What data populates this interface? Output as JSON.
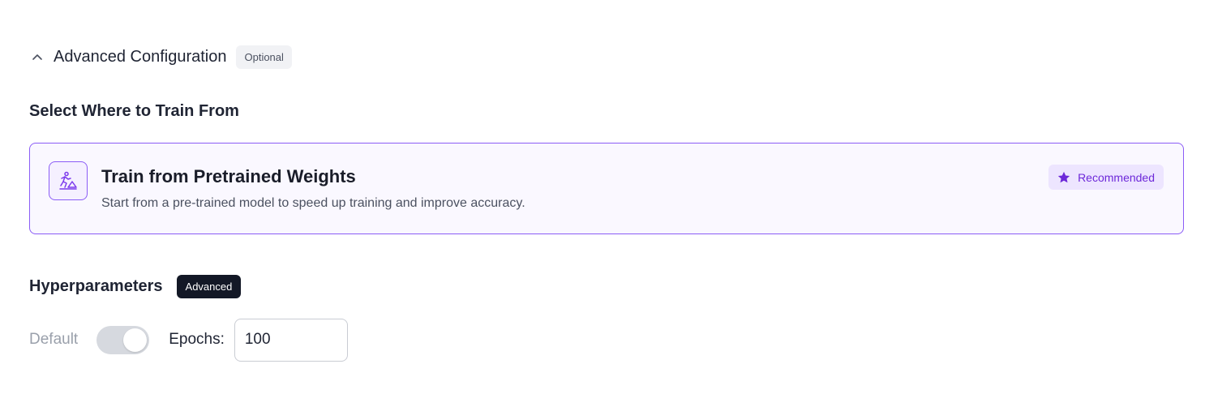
{
  "advanced_config": {
    "title": "Advanced Configuration",
    "badge": "Optional",
    "icon": "chevron-up-icon"
  },
  "train_from": {
    "section_title": "Select Where to Train From",
    "option": {
      "title": "Train from Pretrained Weights",
      "description": "Start from a pre-trained model to speed up training and improve accuracy.",
      "badge": "Recommended",
      "icon": "person-sliding-icon",
      "badge_icon": "star-icon",
      "selected": true
    }
  },
  "hyperparameters": {
    "title": "Hyperparameters",
    "badge": "Advanced",
    "default_label": "Default",
    "default_toggle_on": true,
    "epochs_label": "Epochs:",
    "epochs_value": "100"
  },
  "colors": {
    "accent": "#8b5cf6",
    "accent_dark": "#6d28d9",
    "card_bg": "#faf8ff",
    "badge_dark": "#131826"
  }
}
